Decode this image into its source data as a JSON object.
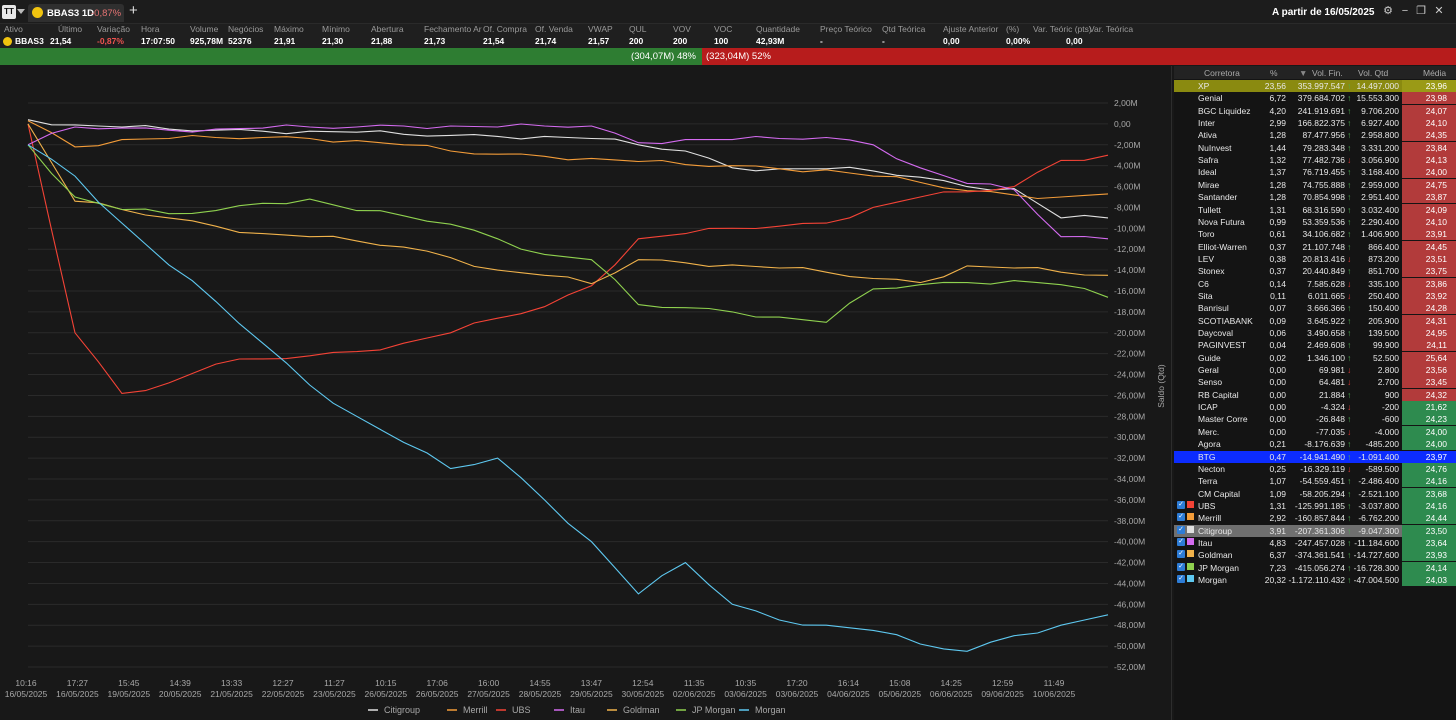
{
  "titlebar": {
    "app_label": "TT",
    "tab_title": "BBAS3 1D",
    "tab_variation": "-0,87%",
    "add_tab": "+",
    "period": "A partir de 16/05/2025",
    "btn_settings": "⚙",
    "btn_minimize": "−",
    "btn_restore": "❐",
    "btn_close": "✕"
  },
  "quote": {
    "headers": [
      "Ativo",
      "Último",
      "Variação",
      "Hora",
      "Volume",
      "Negócios",
      "Máximo",
      "Mínimo",
      "Abertura",
      "Fechamento Ar",
      "Of. Compra",
      "Of. Venda",
      "VWAP",
      "QUL",
      "VOV",
      "VOC",
      "Quantidade",
      "Preço Teórico",
      "Qtd Teórica",
      "Ajuste Anterior",
      "(%)",
      "Var. Teóric (pts)",
      "Var. Teórica"
    ],
    "values": [
      "BBAS3",
      "21,54",
      "-0,87%",
      "17:07:50",
      "925,78M",
      "52376",
      "21,91",
      "21,30",
      "21,88",
      "21,73",
      "21,54",
      "21,74",
      "21,57",
      "200",
      "200",
      "100",
      "42,93M",
      "-",
      "-",
      "0,00",
      "0,00%",
      "0,00",
      ""
    ]
  },
  "pressure": {
    "buy_label": "(304,07M) 48%",
    "sell_label": "(323,04M) 52%"
  },
  "colors": {
    "Citigroup": "#e0e0e0",
    "Merrill": "#f39c39",
    "UBS": "#f44336",
    "Itau": "#d46bf0",
    "Goldman": "#f0b24b",
    "JP Morgan": "#8fd14f",
    "Morgan": "#5ec8f0"
  },
  "chart_data": {
    "type": "line",
    "ylabel": "Saldo (Qtd)",
    "y_unit": "M",
    "ylim": [
      -52,
      2
    ],
    "y_ticks": [
      "2,00M",
      "0,00",
      "-2,00M",
      "-4,00M",
      "-6,00M",
      "-8,00M",
      "-10,00M",
      "-12,00M",
      "-14,00M",
      "-16,00M",
      "-18,00M",
      "-20,00M",
      "-22,00M",
      "-24,00M",
      "-26,00M",
      "-28,00M",
      "-30,00M",
      "-32,00M",
      "-34,00M",
      "-36,00M",
      "-38,00M",
      "-40,00M",
      "-42,00M",
      "-44,00M",
      "-46,00M",
      "-48,00M",
      "-50,00M",
      "-52,00M"
    ],
    "x_ticks": [
      [
        "10:16",
        "16/05/2025"
      ],
      [
        "17:27",
        "16/05/2025"
      ],
      [
        "15:45",
        "19/05/2025"
      ],
      [
        "14:39",
        "20/05/2025"
      ],
      [
        "13:33",
        "21/05/2025"
      ],
      [
        "12:27",
        "22/05/2025"
      ],
      [
        "11:27",
        "23/05/2025"
      ],
      [
        "10:15",
        "26/05/2025"
      ],
      [
        "17:06",
        "26/05/2025"
      ],
      [
        "16:00",
        "27/05/2025"
      ],
      [
        "14:55",
        "28/05/2025"
      ],
      [
        "13:47",
        "29/05/2025"
      ],
      [
        "12:54",
        "30/05/2025"
      ],
      [
        "11:35",
        "02/06/2025"
      ],
      [
        "10:35",
        "03/06/2025"
      ],
      [
        "17:20",
        "03/06/2025"
      ],
      [
        "16:14",
        "04/06/2025"
      ],
      [
        "15:08",
        "05/06/2025"
      ],
      [
        "14:25",
        "06/06/2025"
      ],
      [
        "12:59",
        "09/06/2025"
      ],
      [
        "11:49",
        "10/06/2025"
      ]
    ],
    "grid": true,
    "legend_position": "bottom",
    "series": [
      {
        "name": "Citigroup",
        "values": [
          0.4,
          -0.1,
          -0.3,
          -0.5,
          -0.6,
          -0.7,
          -0.7,
          -0.8,
          -1.0,
          -1.1,
          -1.2,
          -1.2,
          -1.4,
          -2.0,
          -2.6,
          -4.2,
          -4.3,
          -4.3,
          -4.5,
          -5.1,
          -6.0,
          -6.2,
          -9.0,
          -9.0
        ]
      },
      {
        "name": "Merrill",
        "values": [
          0.3,
          -2.2,
          -1.5,
          -1.4,
          -1.3,
          -1.3,
          -1.4,
          -1.6,
          -2.0,
          -2.6,
          -2.9,
          -3.1,
          -3.3,
          -3.6,
          -3.9,
          -4.0,
          -4.3,
          -4.4,
          -5.0,
          -5.6,
          -6.4,
          -6.8,
          -7.0,
          -6.7
        ]
      },
      {
        "name": "UBS",
        "values": [
          0.0,
          -20.0,
          -25.8,
          -24.8,
          -23.0,
          -22.5,
          -22.2,
          -21.8,
          -21.0,
          -20.0,
          -18.6,
          -17.5,
          -15.5,
          -11.0,
          -10.5,
          -10.0,
          -9.8,
          -9.5,
          -8.0,
          -7.0,
          -6.5,
          -6.0,
          -3.5,
          -3.0
        ]
      },
      {
        "name": "Itau",
        "values": [
          -2.0,
          -0.3,
          -0.4,
          -0.6,
          -0.5,
          -0.4,
          -0.3,
          -0.3,
          -0.2,
          -0.2,
          -0.3,
          -0.2,
          -0.2,
          -1.8,
          -1.5,
          -1.5,
          -1.4,
          -1.3,
          -2.0,
          -4.2,
          -5.7,
          -6.3,
          -10.8,
          -11.0
        ]
      },
      {
        "name": "Goldman",
        "values": [
          0.0,
          -7.4,
          -8.2,
          -9.0,
          -9.8,
          -10.5,
          -10.8,
          -11.2,
          -11.8,
          -12.8,
          -14.0,
          -14.5,
          -15.3,
          -13.0,
          -13.3,
          -13.5,
          -13.8,
          -14.2,
          -14.8,
          -15.2,
          -13.6,
          -13.8,
          -14.2,
          -14.5
        ]
      },
      {
        "name": "JP Morgan",
        "values": [
          -2.0,
          -7.0,
          -8.2,
          -8.6,
          -8.3,
          -7.6,
          -7.2,
          -8.3,
          -8.8,
          -9.6,
          -11.0,
          -12.5,
          -13.0,
          -17.3,
          -17.6,
          -18.0,
          -18.5,
          -19.0,
          -15.8,
          -15.4,
          -15.2,
          -15.0,
          -15.4,
          -16.6
        ]
      },
      {
        "name": "Morgan",
        "values": [
          -2.0,
          -5.0,
          -9.5,
          -13.5,
          -17.0,
          -21.0,
          -25.0,
          -28.0,
          -30.5,
          -33.0,
          -32.0,
          -36.0,
          -40.0,
          -45.0,
          -42.0,
          -46.0,
          -47.5,
          -48.0,
          -48.5,
          -49.8,
          -50.5,
          -49.0,
          -48.0,
          -47.0
        ]
      }
    ]
  },
  "ranking": {
    "headers": {
      "broker": "Corretora",
      "pct": "%",
      "fin": "Vol. Fin.",
      "qty": "Vol. Qtd",
      "avg": "Média"
    },
    "rows": [
      {
        "broker": "XP",
        "pct": "23,56",
        "fin": "353.997.547",
        "arrow": "up",
        "qty": "14.497.000",
        "avg": "23,96",
        "style": "xp"
      },
      {
        "broker": "Genial",
        "pct": "6,72",
        "fin": "379.684.702",
        "arrow": "up",
        "qty": "15.553.300",
        "avg": "23,98",
        "style": "red"
      },
      {
        "broker": "BGC Liquidez",
        "pct": "4,20",
        "fin": "241.919.691",
        "arrow": "up",
        "qty": "9.706.200",
        "avg": "24,07",
        "style": "red"
      },
      {
        "broker": "Inter",
        "pct": "2,99",
        "fin": "166.822.375",
        "arrow": "up",
        "qty": "6.927.400",
        "avg": "24,10",
        "style": "red"
      },
      {
        "broker": "Ativa",
        "pct": "1,28",
        "fin": "87.477.956",
        "arrow": "up",
        "qty": "2.958.800",
        "avg": "24,35",
        "style": "red"
      },
      {
        "broker": "NuInvest",
        "pct": "1,44",
        "fin": "79.283.348",
        "arrow": "up",
        "qty": "3.331.200",
        "avg": "23,84",
        "style": "red"
      },
      {
        "broker": "Safra",
        "pct": "1,32",
        "fin": "77.482.736",
        "arrow": "dn",
        "qty": "3.056.900",
        "avg": "24,13",
        "style": "red"
      },
      {
        "broker": "Ideal",
        "pct": "1,37",
        "fin": "76.719.455",
        "arrow": "up",
        "qty": "3.168.400",
        "avg": "24,00",
        "style": "red"
      },
      {
        "broker": "Mirae",
        "pct": "1,28",
        "fin": "74.755.888",
        "arrow": "up",
        "qty": "2.959.000",
        "avg": "24,75",
        "style": "red"
      },
      {
        "broker": "Santander",
        "pct": "1,28",
        "fin": "70.854.998",
        "arrow": "up",
        "qty": "2.951.400",
        "avg": "23,87",
        "style": "red"
      },
      {
        "broker": "Tullett",
        "pct": "1,31",
        "fin": "68.316.590",
        "arrow": "up",
        "qty": "3.032.400",
        "avg": "24,09",
        "style": "red"
      },
      {
        "broker": "Nova Futura",
        "pct": "0,99",
        "fin": "53.359.536",
        "arrow": "up",
        "qty": "2.290.400",
        "avg": "24,10",
        "style": "red"
      },
      {
        "broker": "Toro",
        "pct": "0,61",
        "fin": "34.106.682",
        "arrow": "up",
        "qty": "1.406.900",
        "avg": "23,91",
        "style": "red"
      },
      {
        "broker": "Elliot-Warren",
        "pct": "0,37",
        "fin": "21.107.748",
        "arrow": "up",
        "qty": "866.400",
        "avg": "24,45",
        "style": "red"
      },
      {
        "broker": "LEV",
        "pct": "0,38",
        "fin": "20.813.416",
        "arrow": "dn",
        "qty": "873.200",
        "avg": "23,51",
        "style": "red"
      },
      {
        "broker": "Stonex",
        "pct": "0,37",
        "fin": "20.440.849",
        "arrow": "up",
        "qty": "851.700",
        "avg": "23,75",
        "style": "red"
      },
      {
        "broker": "C6",
        "pct": "0,14",
        "fin": "7.585.628",
        "arrow": "dn",
        "qty": "335.100",
        "avg": "23,86",
        "style": "red"
      },
      {
        "broker": "Sita",
        "pct": "0,11",
        "fin": "6.011.665",
        "arrow": "dn",
        "qty": "250.400",
        "avg": "23,92",
        "style": "red"
      },
      {
        "broker": "Banrisul",
        "pct": "0,07",
        "fin": "3.666.366",
        "arrow": "up",
        "qty": "150.400",
        "avg": "24,28",
        "style": "red"
      },
      {
        "broker": "SCOTIABANK",
        "pct": "0,09",
        "fin": "3.645.922",
        "arrow": "up",
        "qty": "205.900",
        "avg": "24,31",
        "style": "red"
      },
      {
        "broker": "Daycoval",
        "pct": "0,06",
        "fin": "3.490.658",
        "arrow": "up",
        "qty": "139.500",
        "avg": "24,95",
        "style": "red"
      },
      {
        "broker": "PAGINVEST",
        "pct": "0,04",
        "fin": "2.469.608",
        "arrow": "up",
        "qty": "99.900",
        "avg": "24,11",
        "style": "red"
      },
      {
        "broker": "Guide",
        "pct": "0,02",
        "fin": "1.346.100",
        "arrow": "up",
        "qty": "52.500",
        "avg": "25,64",
        "style": "red"
      },
      {
        "broker": "Geral",
        "pct": "0,00",
        "fin": "69.981",
        "arrow": "dn",
        "qty": "2.800",
        "avg": "23,56",
        "style": "red"
      },
      {
        "broker": "Senso",
        "pct": "0,00",
        "fin": "64.481",
        "arrow": "dn",
        "qty": "2.700",
        "avg": "23,45",
        "style": "red"
      },
      {
        "broker": "RB Capital",
        "pct": "0,00",
        "fin": "21.884",
        "arrow": "up",
        "qty": "900",
        "avg": "24,32",
        "style": "red"
      },
      {
        "broker": "ICAP",
        "pct": "0,00",
        "fin": "-4.324",
        "arrow": "dn",
        "qty": "-200",
        "avg": "21,62",
        "style": "green"
      },
      {
        "broker": "Master Corre",
        "pct": "0,00",
        "fin": "-26.848",
        "arrow": "up",
        "qty": "-600",
        "avg": "24,23",
        "style": "green"
      },
      {
        "broker": "Merc.",
        "pct": "0,00",
        "fin": "-77.035",
        "arrow": "dn",
        "qty": "-4.000",
        "avg": "24,00",
        "style": "green"
      },
      {
        "broker": "Agora",
        "pct": "0,21",
        "fin": "-8.176.639",
        "arrow": "up",
        "qty": "-485.200",
        "avg": "24,00",
        "style": "green"
      },
      {
        "broker": "BTG",
        "pct": "0,47",
        "fin": "-14.941.490",
        "arrow": "up",
        "qty": "-1.091.400",
        "avg": "23,97",
        "style": "btg"
      },
      {
        "broker": "Necton",
        "pct": "0,25",
        "fin": "-16.329.119",
        "arrow": "dn",
        "qty": "-589.500",
        "avg": "24,76",
        "style": "green"
      },
      {
        "broker": "Terra",
        "pct": "1,07",
        "fin": "-54.559.451",
        "arrow": "up",
        "qty": "-2.486.400",
        "avg": "24,16",
        "style": "green"
      },
      {
        "broker": "CM Capital",
        "pct": "1,09",
        "fin": "-58.205.294",
        "arrow": "up",
        "qty": "-2.521.100",
        "avg": "23,68",
        "style": "green"
      },
      {
        "broker": "UBS",
        "pct": "1,31",
        "fin": "-125.991.185",
        "arrow": "up",
        "qty": "-3.037.800",
        "avg": "24,16",
        "style": "green",
        "checked": true,
        "swatch": "UBS"
      },
      {
        "broker": "Merrill",
        "pct": "2,92",
        "fin": "-160.857.844",
        "arrow": "up",
        "qty": "-6.762.200",
        "avg": "24,44",
        "style": "green",
        "checked": true,
        "swatch": "Merrill"
      },
      {
        "broker": "Citigroup",
        "pct": "3,91",
        "fin": "-207.361.306",
        "arrow": "up",
        "qty": "-9.047.300",
        "avg": "23,50",
        "style": "citi",
        "checked": true,
        "swatch": "Citigroup"
      },
      {
        "broker": "Itau",
        "pct": "4,83",
        "fin": "-247.457.028",
        "arrow": "up",
        "qty": "-11.184.600",
        "avg": "23,64",
        "style": "green",
        "checked": true,
        "swatch": "Itau"
      },
      {
        "broker": "Goldman",
        "pct": "6,37",
        "fin": "-374.361.541",
        "arrow": "up",
        "qty": "-14.727.600",
        "avg": "23,93",
        "style": "green",
        "checked": true,
        "swatch": "Goldman"
      },
      {
        "broker": "JP Morgan",
        "pct": "7,23",
        "fin": "-415.056.274",
        "arrow": "up",
        "qty": "-16.728.300",
        "avg": "24,14",
        "style": "green",
        "checked": true,
        "swatch": "JP Morgan"
      },
      {
        "broker": "Morgan",
        "pct": "20,32",
        "fin": "-1.172.110.432",
        "arrow": "up",
        "qty": "-47.004.500",
        "avg": "24,03",
        "style": "green",
        "checked": true,
        "swatch": "Morgan"
      }
    ]
  }
}
